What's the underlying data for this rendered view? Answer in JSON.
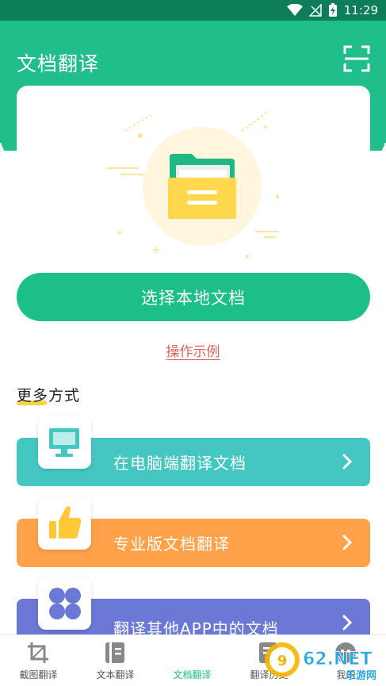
{
  "status_bar": {
    "time": "11:29"
  },
  "header": {
    "title": "文档翻译"
  },
  "primary_action": {
    "label": "选择本地文档"
  },
  "example_link": {
    "label": "操作示例"
  },
  "more_section": {
    "title": "更多方式"
  },
  "options": [
    {
      "label": "在电脑端翻译文档",
      "color": "#44C7C3"
    },
    {
      "label": "专业版文档翻译",
      "color": "#FFA24A"
    },
    {
      "label": "翻译其他APP中的文档",
      "color": "#6B78D6"
    }
  ],
  "bottom_nav": [
    {
      "label": "截图翻译",
      "icon": "crop-icon",
      "active": false
    },
    {
      "label": "文本翻译",
      "icon": "book-icon",
      "active": false
    },
    {
      "label": "文档翻译",
      "icon": "document-icon",
      "active": true
    },
    {
      "label": "翻译历史",
      "icon": "history-icon",
      "active": false
    },
    {
      "label": "我的",
      "icon": "profile-icon",
      "active": false
    }
  ],
  "watermark": {
    "text": "962.NET",
    "subtext": "乐游网"
  },
  "colors": {
    "brand": "#1FBE8A",
    "status_bar": "#0E7E5A",
    "link": "#E0605E",
    "accent_yellow": "#FFD24A"
  }
}
